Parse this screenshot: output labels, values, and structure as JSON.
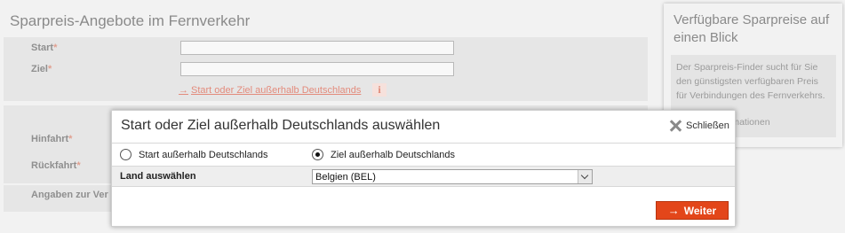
{
  "page": {
    "title": "Sparpreis-Angebote im Fernverkehr",
    "start_label": "Start",
    "ziel_label": "Ziel",
    "required_mark": "*",
    "outside_link": "Start oder Ziel außerhalb Deutschlands",
    "hinfahrt_label": "Hinfahrt",
    "rueckfahrt_label": "Rückfahrt",
    "angaben_label": "Angaben zur Ver"
  },
  "sidebar": {
    "title": "Verfügbare Sparpreise auf einen Blick",
    "body": "Der Sparpreis-Finder sucht für Sie den günstigsten verfügbaren Preis für Verbindungen des Fernverkehrs.",
    "more": "ormationen"
  },
  "modal": {
    "title": "Start oder Ziel außerhalb Deutschlands auswählen",
    "close_label": "Schließen",
    "radio_start_label": "Start außerhalb Deutschlands",
    "radio_ziel_label": "Ziel außerhalb Deutschlands",
    "selected_radio": "ziel",
    "land_label": "Land auswählen",
    "land_value": "Belgien (BEL)",
    "weiter_label": "Weiter"
  },
  "colors": {
    "accent": "#e3461a",
    "link": "#e38b7c"
  }
}
